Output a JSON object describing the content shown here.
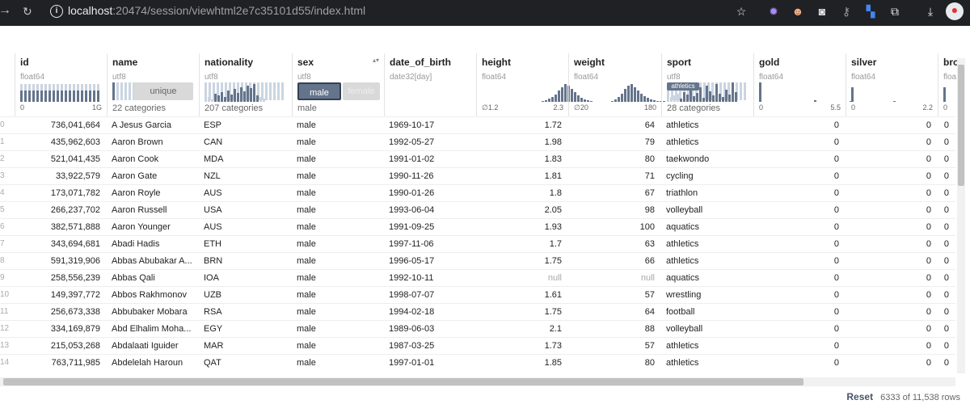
{
  "browser": {
    "back_icon": "arrow-left",
    "reload_icon": "reload",
    "url_host": "localhost",
    "url_path": ":20474/session/viewhtml2e7c35101d55/index.html"
  },
  "columns": [
    {
      "name": "id",
      "type": "float64",
      "lo": "0",
      "hi": "1G"
    },
    {
      "name": "name",
      "type": "utf8",
      "foot": "22 categories",
      "pill": "unique"
    },
    {
      "name": "nationality",
      "type": "utf8",
      "foot": "207 categories"
    },
    {
      "name": "sex",
      "type": "utf8",
      "foot": "male",
      "pill_a": "male",
      "pill_b": "female"
    },
    {
      "name": "date_of_birth",
      "type": "date32[day]"
    },
    {
      "name": "height",
      "type": "float64",
      "lo": "∅1.2",
      "hi": "2.3"
    },
    {
      "name": "weight",
      "type": "float64",
      "lo": "∅20",
      "hi": "180"
    },
    {
      "name": "sport",
      "type": "utf8",
      "foot": "28 categories",
      "pill": "athletics"
    },
    {
      "name": "gold",
      "type": "float64",
      "lo": "0",
      "hi": "5.5"
    },
    {
      "name": "silver",
      "type": "float64",
      "lo": "0",
      "hi": "2.2"
    },
    {
      "name": "bro",
      "type": "floa",
      "lo": "0"
    }
  ],
  "rows": [
    {
      "i": "0",
      "id": "736,041,664",
      "name": "A Jesus Garcia",
      "nat": "ESP",
      "sex": "male",
      "dob": "1969-10-17",
      "h": "1.72",
      "w": "64",
      "sport": "athletics",
      "g": "0",
      "s": "0"
    },
    {
      "i": "1",
      "id": "435,962,603",
      "name": "Aaron Brown",
      "nat": "CAN",
      "sex": "male",
      "dob": "1992-05-27",
      "h": "1.98",
      "w": "79",
      "sport": "athletics",
      "g": "0",
      "s": "0"
    },
    {
      "i": "2",
      "id": "521,041,435",
      "name": "Aaron Cook",
      "nat": "MDA",
      "sex": "male",
      "dob": "1991-01-02",
      "h": "1.83",
      "w": "80",
      "sport": "taekwondo",
      "g": "0",
      "s": "0"
    },
    {
      "i": "3",
      "id": "33,922,579",
      "name": "Aaron Gate",
      "nat": "NZL",
      "sex": "male",
      "dob": "1990-11-26",
      "h": "1.81",
      "w": "71",
      "sport": "cycling",
      "g": "0",
      "s": "0"
    },
    {
      "i": "4",
      "id": "173,071,782",
      "name": "Aaron Royle",
      "nat": "AUS",
      "sex": "male",
      "dob": "1990-01-26",
      "h": "1.8",
      "w": "67",
      "sport": "triathlon",
      "g": "0",
      "s": "0"
    },
    {
      "i": "5",
      "id": "266,237,702",
      "name": "Aaron Russell",
      "nat": "USA",
      "sex": "male",
      "dob": "1993-06-04",
      "h": "2.05",
      "w": "98",
      "sport": "volleyball",
      "g": "0",
      "s": "0"
    },
    {
      "i": "6",
      "id": "382,571,888",
      "name": "Aaron Younger",
      "nat": "AUS",
      "sex": "male",
      "dob": "1991-09-25",
      "h": "1.93",
      "w": "100",
      "sport": "aquatics",
      "g": "0",
      "s": "0"
    },
    {
      "i": "7",
      "id": "343,694,681",
      "name": "Abadi Hadis",
      "nat": "ETH",
      "sex": "male",
      "dob": "1997-11-06",
      "h": "1.7",
      "w": "63",
      "sport": "athletics",
      "g": "0",
      "s": "0"
    },
    {
      "i": "8",
      "id": "591,319,906",
      "name": "Abbas Abubakar A...",
      "nat": "BRN",
      "sex": "male",
      "dob": "1996-05-17",
      "h": "1.75",
      "w": "66",
      "sport": "athletics",
      "g": "0",
      "s": "0"
    },
    {
      "i": "9",
      "id": "258,556,239",
      "name": "Abbas Qali",
      "nat": "IOA",
      "sex": "male",
      "dob": "1992-10-11",
      "h": "null",
      "w": "null",
      "sport": "aquatics",
      "g": "0",
      "s": "0"
    },
    {
      "i": "10",
      "id": "149,397,772",
      "name": "Abbos Rakhmonov",
      "nat": "UZB",
      "sex": "male",
      "dob": "1998-07-07",
      "h": "1.61",
      "w": "57",
      "sport": "wrestling",
      "g": "0",
      "s": "0"
    },
    {
      "i": "11",
      "id": "256,673,338",
      "name": "Abbubaker Mobara",
      "nat": "RSA",
      "sex": "male",
      "dob": "1994-02-18",
      "h": "1.75",
      "w": "64",
      "sport": "football",
      "g": "0",
      "s": "0"
    },
    {
      "i": "12",
      "id": "334,169,879",
      "name": "Abd Elhalim Moha...",
      "nat": "EGY",
      "sex": "male",
      "dob": "1989-06-03",
      "h": "2.1",
      "w": "88",
      "sport": "volleyball",
      "g": "0",
      "s": "0"
    },
    {
      "i": "13",
      "id": "215,053,268",
      "name": "Abdalaati Iguider",
      "nat": "MAR",
      "sex": "male",
      "dob": "1987-03-25",
      "h": "1.73",
      "w": "57",
      "sport": "athletics",
      "g": "0",
      "s": "0"
    },
    {
      "i": "14",
      "id": "763,711,985",
      "name": "Abdelelah Haroun",
      "nat": "QAT",
      "sex": "male",
      "dob": "1997-01-01",
      "h": "1.85",
      "w": "80",
      "sport": "athletics",
      "g": "0",
      "s": "0"
    }
  ],
  "footer": {
    "reset": "Reset",
    "count": "6333 of 11,538 rows"
  }
}
